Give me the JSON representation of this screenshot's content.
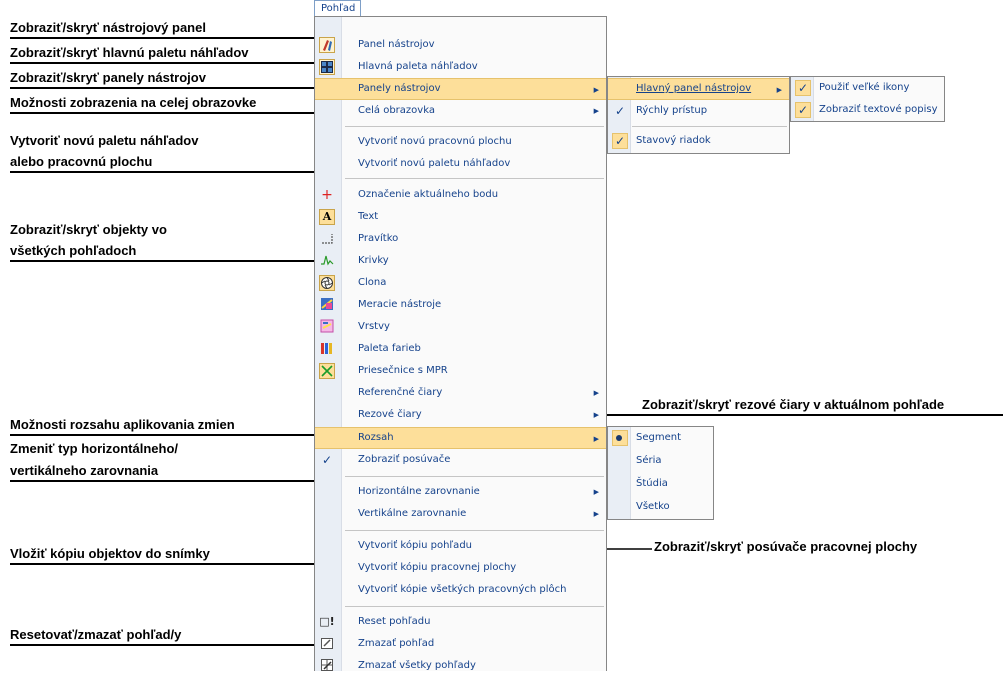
{
  "menu_title": "Pohľad",
  "annotations": [
    "Zobraziť/skryť nástrojový panel",
    "Zobraziť/skryť hlavnú paletu náhľadov",
    "Zobraziť/skryť panely nástrojov",
    "Možnosti zobrazenia na celej obrazovke",
    "Vytvoriť novú paletu náhľadov",
    "alebo pracovnú plochu",
    "Zobraziť/skryť objekty vo",
    "všetkých pohľadoch",
    "Možnosti rozsahu aplikovania zmien",
    "Zmeniť typ horizontálneho/",
    "vertikálneho zarovnania",
    "Vložiť kópiu objektov do snímky",
    "Resetovať/zmazať pohľad/y",
    "Zobraziť/skryť rezové čiary v aktuálnom pohľade",
    "Zobraziť/skryť posúvače pracovnej plochy"
  ],
  "main_menu": {
    "items": [
      "Panel nástrojov",
      "Hlavná paleta náhľadov",
      "Panely nástrojov",
      "Celá obrazovka",
      "Vytvoriť novú pracovnú plochu",
      "Vytvoriť novú paletu náhľadov",
      "Označenie aktuálneho bodu",
      "Text",
      "Pravítko",
      "Krivky",
      "Clona",
      "Meracie nástroje",
      "Vrstvy",
      "Paleta farieb",
      "Priesečnice s MPR",
      "Referenčné čiary",
      "Rezové čiary",
      "Rozsah",
      "Zobraziť posúvače",
      "Horizontálne zarovnanie",
      "Vertikálne zarovnanie",
      "Vytvoriť kópiu pohľadu",
      "Vytvoriť kópiu pracovnej plochy",
      "Vytvoriť kópie všetkých pracovných plôch",
      "Reset pohľadu",
      "Zmazať pohľad",
      "Zmazať všetky pohľady"
    ]
  },
  "submenu_panels": [
    "Hlavný panel nástrojov",
    "Rýchly prístup",
    "Stavový riadok"
  ],
  "submenu_main_toolbar": [
    "Použiť veľké ikony",
    "Zobraziť textové popisy"
  ],
  "submenu_scope": [
    "Segment",
    "Séria",
    "Štúdia",
    "Všetko"
  ],
  "colors": {
    "highlight": "#fddf9a",
    "menu_text": "#15428b",
    "gutter": "#e9eef5"
  }
}
